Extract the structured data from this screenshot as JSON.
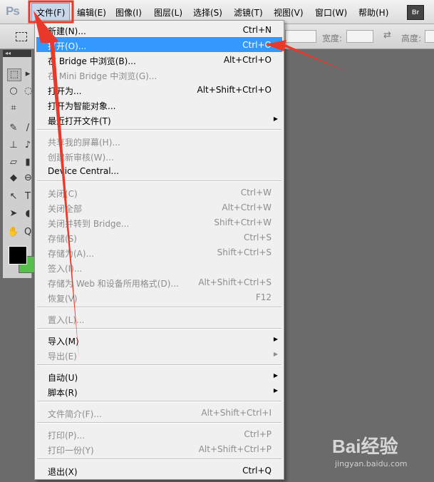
{
  "app_logo": "Ps",
  "menubar": {
    "items": [
      "文件(F)",
      "编辑(E)",
      "图像(I)",
      "图层(L)",
      "选择(S)",
      "滤镜(T)",
      "视图(V)",
      "窗口(W)",
      "帮助(H)"
    ],
    "active_index": 0,
    "br_button": "Br"
  },
  "options_bar": {
    "width_label": "宽度:",
    "height_label": "高度:"
  },
  "toolbox": {
    "header": "◂◂"
  },
  "file_menu": {
    "items": [
      {
        "label": "新建(N)...",
        "shortcut": "Ctrl+N"
      },
      {
        "label": "打开(O)...",
        "shortcut": "Ctrl+O",
        "highlighted": true
      },
      {
        "label": "在 Bridge 中浏览(B)...",
        "shortcut": "Alt+Ctrl+O"
      },
      {
        "label": "在 Mini Bridge 中浏览(G)...",
        "shortcut": "",
        "disabled": true
      },
      {
        "label": "打开为...",
        "shortcut": "Alt+Shift+Ctrl+O"
      },
      {
        "label": "打开为智能对象...",
        "shortcut": ""
      },
      {
        "label": "最近打开文件(T)",
        "shortcut": "",
        "submenu": true
      },
      {
        "label": "共享我的屏幕(H)...",
        "shortcut": "",
        "disabled": true
      },
      {
        "label": "创建新审核(W)...",
        "shortcut": "",
        "disabled": true
      },
      {
        "label": "Device Central...",
        "shortcut": ""
      },
      {
        "label": "关闭(C)",
        "shortcut": "Ctrl+W",
        "disabled": true
      },
      {
        "label": "关闭全部",
        "shortcut": "Alt+Ctrl+W",
        "disabled": true
      },
      {
        "label": "关闭并转到 Bridge...",
        "shortcut": "Shift+Ctrl+W",
        "disabled": true
      },
      {
        "label": "存储(S)",
        "shortcut": "Ctrl+S",
        "disabled": true
      },
      {
        "label": "存储为(A)...",
        "shortcut": "Shift+Ctrl+S",
        "disabled": true
      },
      {
        "label": "签入(I)...",
        "shortcut": "",
        "disabled": true
      },
      {
        "label": "存储为 Web 和设备所用格式(D)...",
        "shortcut": "Alt+Shift+Ctrl+S",
        "disabled": true
      },
      {
        "label": "恢复(V)",
        "shortcut": "F12",
        "disabled": true
      },
      {
        "label": "置入(L)...",
        "shortcut": "",
        "disabled": true
      },
      {
        "label": "导入(M)",
        "shortcut": "",
        "submenu": true
      },
      {
        "label": "导出(E)",
        "shortcut": "",
        "submenu": true,
        "disabled": true
      },
      {
        "label": "自动(U)",
        "shortcut": "",
        "submenu": true
      },
      {
        "label": "脚本(R)",
        "shortcut": "",
        "submenu": true
      },
      {
        "label": "文件简介(F)...",
        "shortcut": "Alt+Shift+Ctrl+I",
        "disabled": true
      },
      {
        "label": "打印(P)...",
        "shortcut": "Ctrl+P",
        "disabled": true
      },
      {
        "label": "打印一份(Y)",
        "shortcut": "Alt+Shift+Ctrl+P",
        "disabled": true
      },
      {
        "label": "退出(X)",
        "shortcut": "Ctrl+Q"
      }
    ]
  },
  "watermark": {
    "brand": "Bai经验",
    "url": "jingyan.baidu.com"
  },
  "colors": {
    "highlight": "#3399ff",
    "annotation": "#e8392a",
    "foreground_swatch": "#000000",
    "background_swatch": "#57c04a"
  }
}
